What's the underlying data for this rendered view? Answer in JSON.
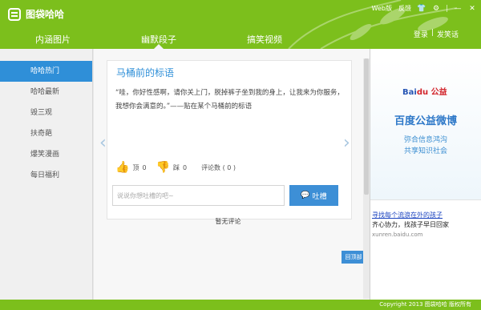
{
  "app": {
    "title": "图袋哈哈"
  },
  "window_controls": {
    "web": "Web版",
    "feedback": "反馈",
    "shirt_icon": "shirt-icon",
    "gear_icon": "gear-icon",
    "minimize_icon": "minimize-icon",
    "close_icon": "close-icon"
  },
  "nav": {
    "tabs": [
      {
        "label": "内涵图片"
      },
      {
        "label": "幽默段子"
      },
      {
        "label": "搞笑视频"
      }
    ]
  },
  "user": {
    "login": "登录",
    "separator": "|",
    "post": "发笑话"
  },
  "sidebar": {
    "items": [
      {
        "label": "哈哈热门"
      },
      {
        "label": "哈哈最新"
      },
      {
        "label": "毁三观"
      },
      {
        "label": "扶奇葩"
      },
      {
        "label": "爆笑漫画"
      },
      {
        "label": "每日福利"
      }
    ]
  },
  "post": {
    "title": "马桶前的标语",
    "body": "“哇，你好性感啊，请你关上门，脱掉裤子坐到我的身上，让我来为你服务，我想你会满意的。”——贴在某个马桶前的标语",
    "like_label": "顶",
    "like_count": "0",
    "dislike_label": "踩",
    "dislike_count": "0",
    "comments_label": "评论数 ( 0 )"
  },
  "comment": {
    "placeholder": "说说你想吐槽的吧~",
    "button": "吐槽",
    "empty": "暂无评论"
  },
  "hint": {
    "label": "回顶部"
  },
  "ad": {
    "brand": "Bai",
    "brand_accent": "du",
    "brand_suffix": "公益",
    "big": "百度公益微博",
    "line1": "弥合信息鸿沟",
    "line2": "共享知识社会",
    "link": "寻找每个流浪在外的孩子",
    "desc": "齐心协力，找孩子早日回家",
    "url": "xunren.baidu.com"
  },
  "footer": {
    "copyright": "Copyright 2013 图袋哈哈 版权所有"
  },
  "colors": {
    "brand_green": "#7cbf1c",
    "accent_blue": "#2f8fd8"
  }
}
